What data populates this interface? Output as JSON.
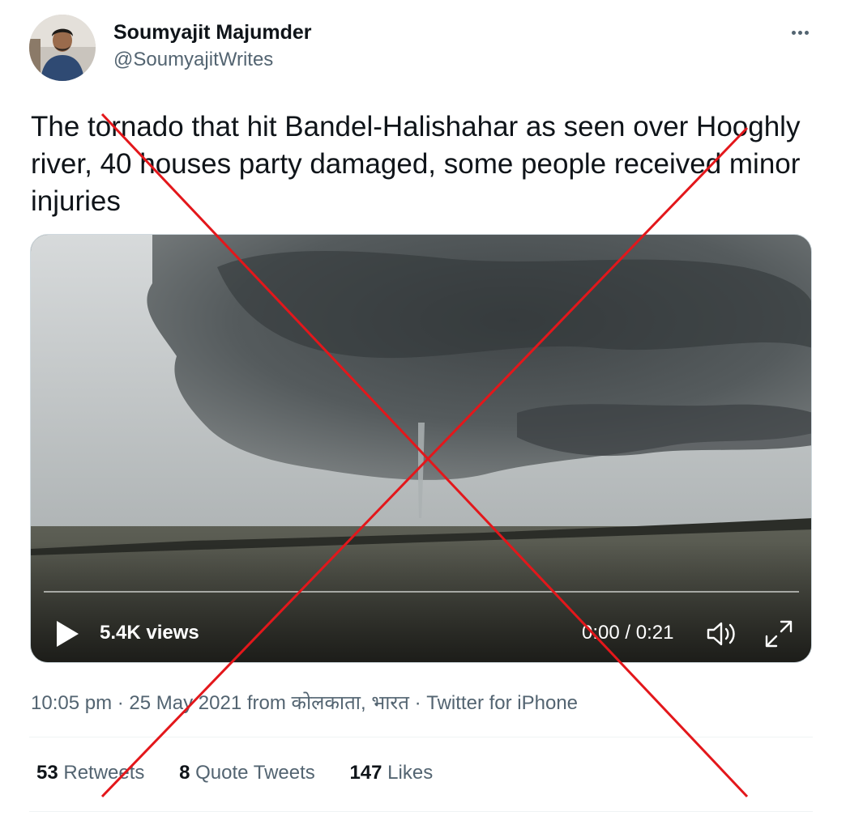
{
  "author": {
    "display_name": "Soumyajit Majumder",
    "handle": "@SoumyajitWrites"
  },
  "tweet": {
    "text": "The tornado that hit Bandel-Halishahar as seen over Hooghly river, 40 houses party damaged, some people received minor injuries"
  },
  "video": {
    "views": "5.4K views",
    "time": "0:00 / 0:21",
    "progress": 0
  },
  "meta": {
    "time": "10:05 pm",
    "date": "25 May 2021",
    "from_prefix": "from",
    "location": "कोलकाता, भारत",
    "source": "Twitter for iPhone",
    "separator": "·"
  },
  "stats": {
    "retweets_count": "53",
    "retweets_label": "Retweets",
    "quotes_count": "8",
    "quotes_label": "Quote Tweets",
    "likes_count": "147",
    "likes_label": "Likes"
  },
  "icons": [
    "more-icon",
    "play-icon",
    "volume-icon",
    "fullscreen-icon"
  ],
  "colors": {
    "text_primary": "#0f1419",
    "text_secondary": "#536471",
    "cross_mark": "#e3171b"
  }
}
